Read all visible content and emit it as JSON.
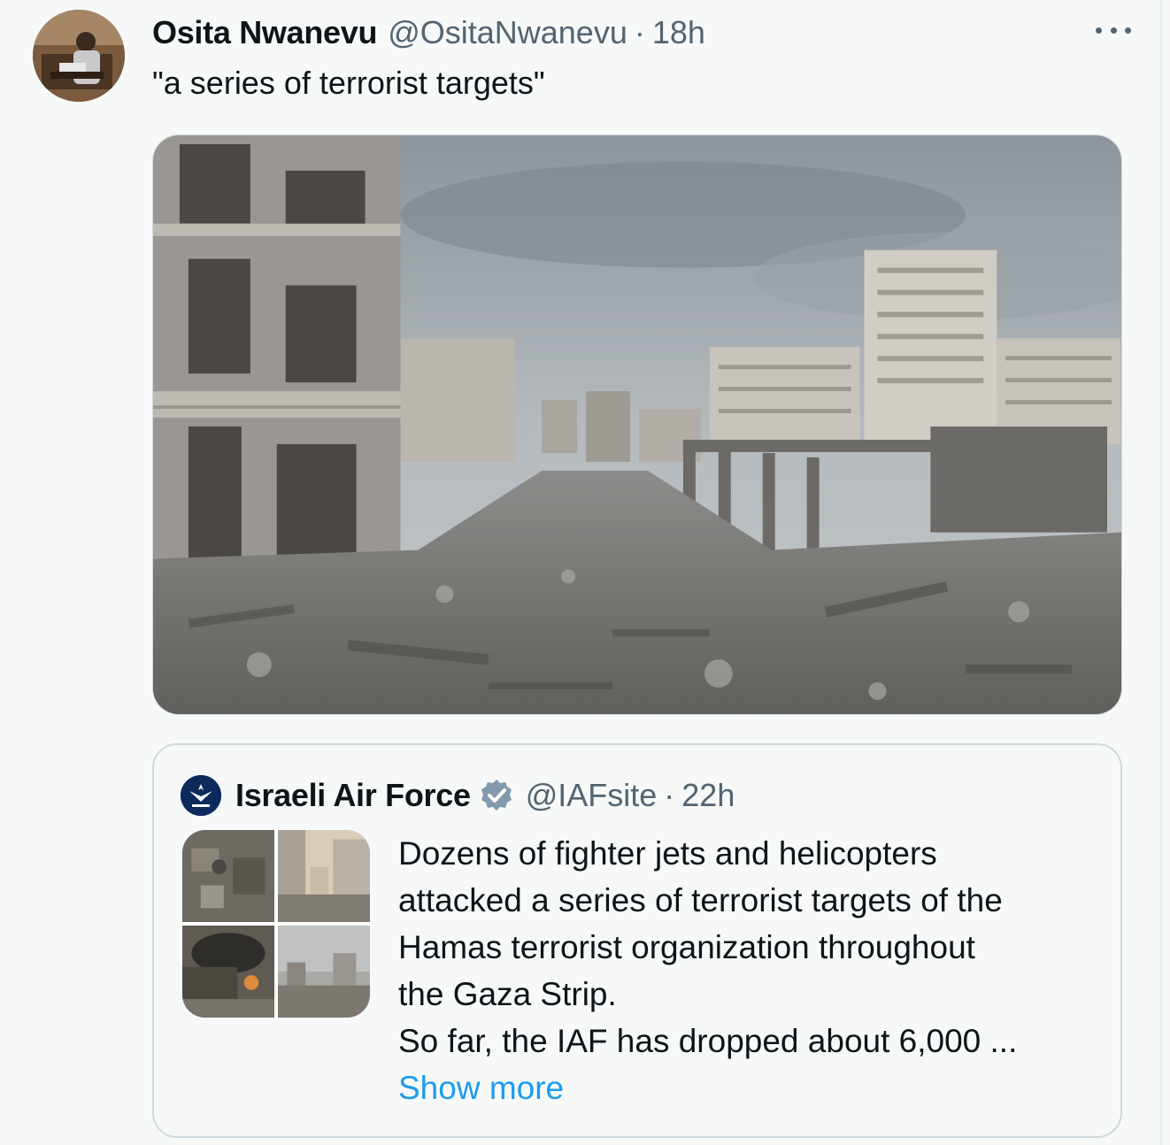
{
  "tweet": {
    "author_name": "Osita Nwanevu",
    "author_handle": "@OsitaNwanevu",
    "separator": "·",
    "time": "18h",
    "text": "\"a series of terrorist targets\"",
    "avatar_icon": "user-avatar",
    "more_icon": "more-icon"
  },
  "quoted": {
    "author_name": "Israeli Air Force",
    "author_handle": "@IAFsite",
    "separator": "·",
    "time": "22h",
    "verified_icon": "verified-badge-icon",
    "logo_icon": "iaf-logo",
    "lines": [
      "Dozens of fighter jets and helicopters",
      "attacked a series of terrorist targets of the",
      "Hamas terrorist organization throughout",
      "the Gaza Strip.",
      "So far, the IAF has dropped about 6,000 ..."
    ],
    "show_more": "Show more"
  },
  "colors": {
    "background": "#f7f9f9",
    "text": "#0f1419",
    "secondary": "#536471",
    "link": "#1d9bf0",
    "border": "#cfd9de"
  }
}
